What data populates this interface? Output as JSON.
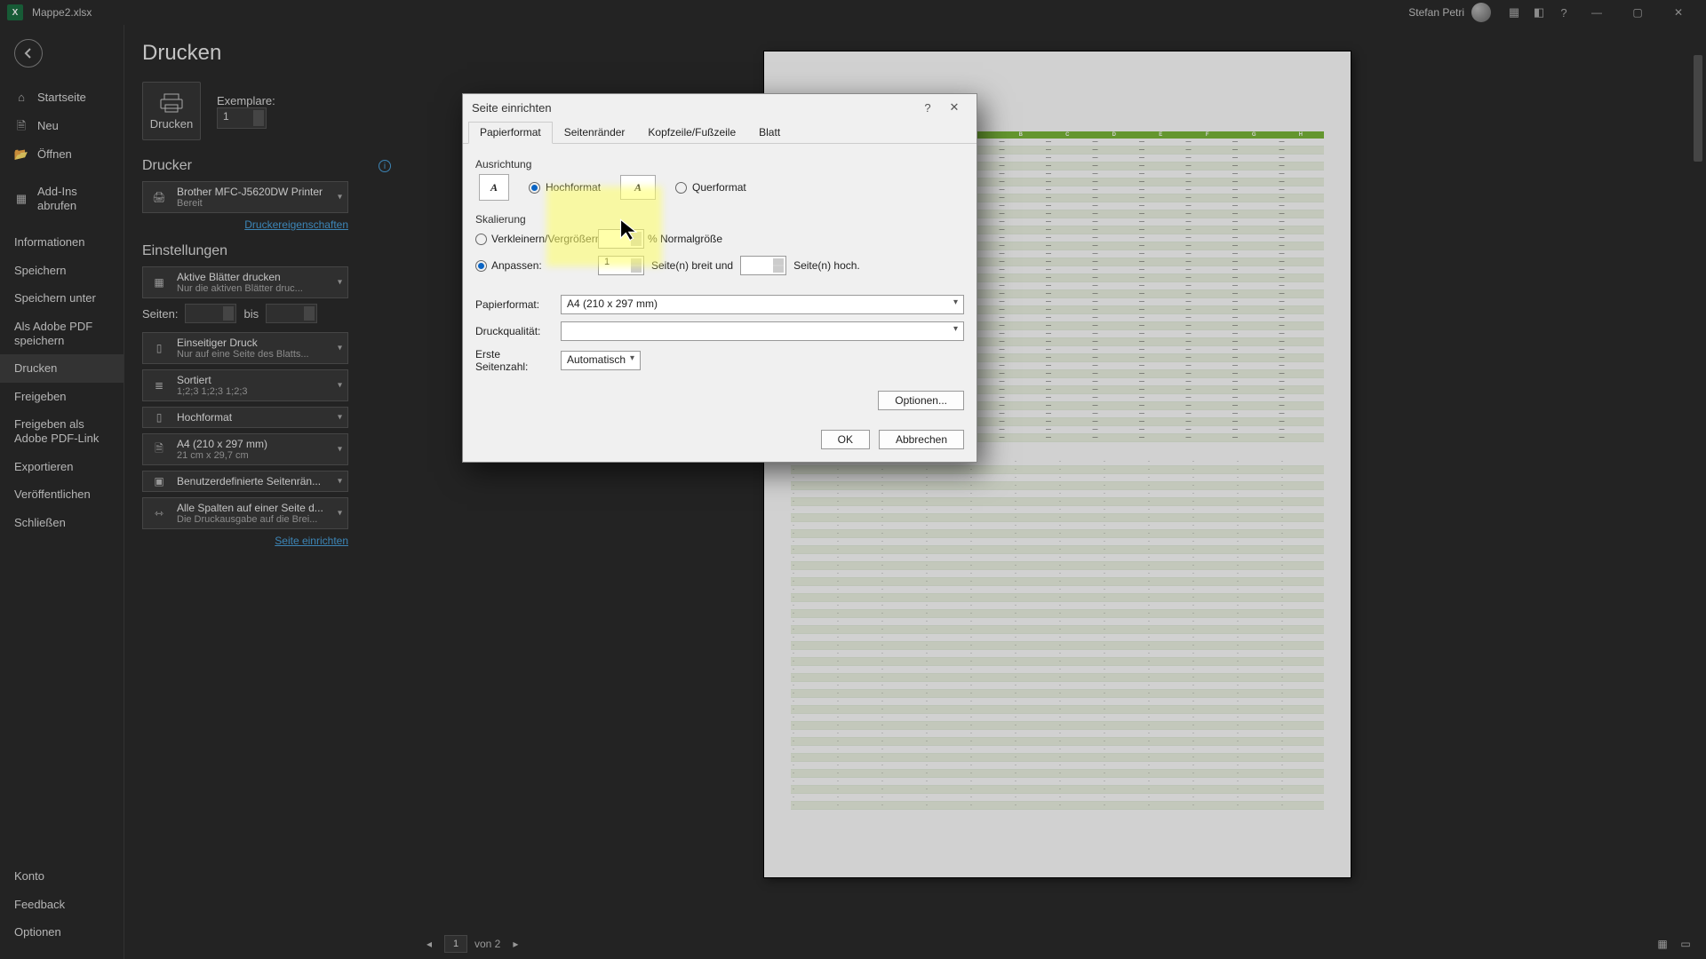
{
  "titlebar": {
    "filename": "Mappe2.xlsx",
    "user": "Stefan Petri"
  },
  "nav": {
    "items": [
      {
        "id": "start",
        "label": "Startseite"
      },
      {
        "id": "new",
        "label": "Neu"
      },
      {
        "id": "open",
        "label": "Öffnen"
      },
      {
        "id": "addins",
        "label": "Add-Ins abrufen"
      },
      {
        "id": "info",
        "label": "Informationen"
      },
      {
        "id": "save",
        "label": "Speichern"
      },
      {
        "id": "saveas",
        "label": "Speichern unter"
      },
      {
        "id": "adobepdf",
        "label": "Als Adobe PDF speichern"
      },
      {
        "id": "print",
        "label": "Drucken"
      },
      {
        "id": "share",
        "label": "Freigeben"
      },
      {
        "id": "adobelink",
        "label": "Freigeben als Adobe PDF-Link"
      },
      {
        "id": "export",
        "label": "Exportieren"
      },
      {
        "id": "publish",
        "label": "Veröffentlichen"
      },
      {
        "id": "close",
        "label": "Schließen"
      }
    ],
    "bottom": [
      {
        "id": "account",
        "label": "Konto"
      },
      {
        "id": "feedback",
        "label": "Feedback"
      },
      {
        "id": "options",
        "label": "Optionen"
      }
    ]
  },
  "print": {
    "heading": "Drucken",
    "button": "Drucken",
    "copies_label": "Exemplare:",
    "copies_value": "1",
    "printer_heading": "Drucker",
    "printer_name": "Brother MFC-J5620DW Printer",
    "printer_status": "Bereit",
    "printer_props_link": "Druckereigenschaften",
    "settings_heading": "Einstellungen",
    "dd_print_scope": {
      "title": "Aktive Blätter drucken",
      "sub": "Nur die aktiven Blätter druc..."
    },
    "pages_label": "Seiten:",
    "pages_to": "bis",
    "dd_duplex": {
      "title": "Einseitiger Druck",
      "sub": "Nur auf eine Seite des Blatts..."
    },
    "dd_collate": {
      "title": "Sortiert",
      "sub": "1;2;3   1;2;3   1;2;3"
    },
    "dd_orientation": {
      "title": "Hochformat"
    },
    "dd_paper": {
      "title": "A4 (210 x 297 mm)",
      "sub": "21 cm x 29,7 cm"
    },
    "dd_margins": {
      "title": "Benutzerdefinierte Seitenrän..."
    },
    "dd_scaling": {
      "title": "Alle Spalten auf einer Seite d...",
      "sub": "Die Druckausgabe auf die Brei..."
    },
    "page_setup_link": "Seite einrichten"
  },
  "dialog": {
    "title": "Seite einrichten",
    "tabs": [
      "Papierformat",
      "Seitenränder",
      "Kopfzeile/Fußzeile",
      "Blatt"
    ],
    "orientation_label": "Ausrichtung",
    "portrait": "Hochformat",
    "landscape": "Querformat",
    "scaling_label": "Skalierung",
    "scale_radio": "Verkleinern/Vergrößern:",
    "scale_suffix": "% Normalgröße",
    "fit_radio": "Anpassen:",
    "fit_wide_value": "1",
    "fit_wide_label": "Seite(n) breit und",
    "fit_tall_value": "",
    "fit_tall_label": "Seite(n) hoch.",
    "paper_label": "Papierformat:",
    "paper_value": "A4 (210 x 297 mm)",
    "quality_label": "Druckqualität:",
    "quality_value": "",
    "first_page_label": "Erste Seitenzahl:",
    "first_page_value": "Automatisch",
    "options_btn": "Optionen...",
    "ok": "OK",
    "cancel": "Abbrechen"
  },
  "preview_footer": {
    "page": "1",
    "of_label": "von 2"
  }
}
